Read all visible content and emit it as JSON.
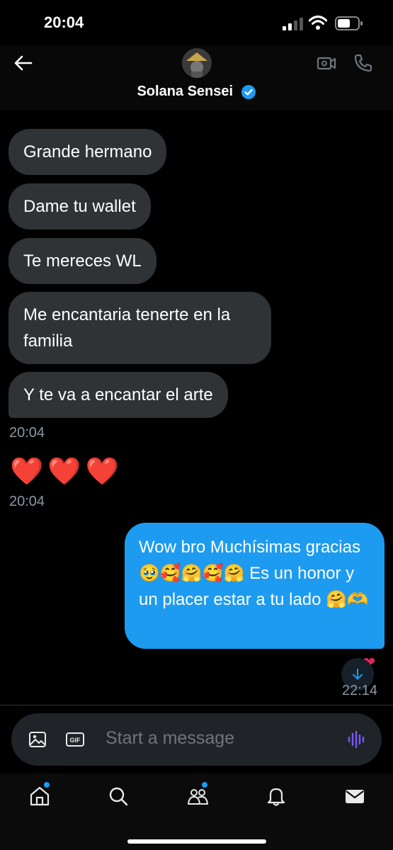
{
  "status": {
    "time": "20:04"
  },
  "header": {
    "contact_name": "Solana Sensei"
  },
  "messages": {
    "incoming": [
      "Grande hermano",
      "Dame tu wallet",
      "Te mereces WL",
      "Me encantaria tenerte en la familia",
      "Y te va a encantar el arte"
    ],
    "incoming_time_1": "20:04",
    "hearts": "❤️❤️❤️",
    "incoming_time_2": "20:04",
    "outgoing": "Wow bro  Muchísimas gracias 🥹🥰🤗🥰🤗   Es un honor y un placer estar a tu lado 🤗🫶",
    "outgoing_time": "22:14",
    "reaction": "❤"
  },
  "composer": {
    "placeholder": "Start a message"
  },
  "icons": {
    "back": "back-arrow-icon",
    "video": "video-call-icon",
    "phone": "phone-icon",
    "image": "image-icon",
    "gif": "gif-icon",
    "voice": "voice-waveform-icon",
    "home": "home-icon",
    "search": "search-icon",
    "communities": "communities-icon",
    "notifications": "bell-icon",
    "messages": "mail-icon"
  },
  "colors": {
    "accent": "#1d9bf0",
    "incoming_bubble": "#2f3336",
    "voice": "#7856ff"
  }
}
